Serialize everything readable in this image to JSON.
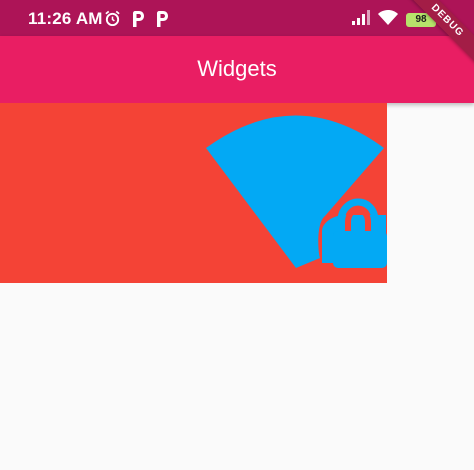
{
  "status_bar": {
    "time": "11:26 AM",
    "left_icons": [
      "alarm-icon",
      "p-icon",
      "p-icon"
    ],
    "right_icons": [
      "signal-icon",
      "wifi-icon",
      "battery-icon"
    ],
    "battery_level": "98"
  },
  "app_bar": {
    "title": "Widgets",
    "color": "#e91e63"
  },
  "content": {
    "background_color": "#f44336",
    "icon": "wifi-lock-icon",
    "icon_color": "#03a9f4"
  },
  "debug_banner": "DEBUG"
}
